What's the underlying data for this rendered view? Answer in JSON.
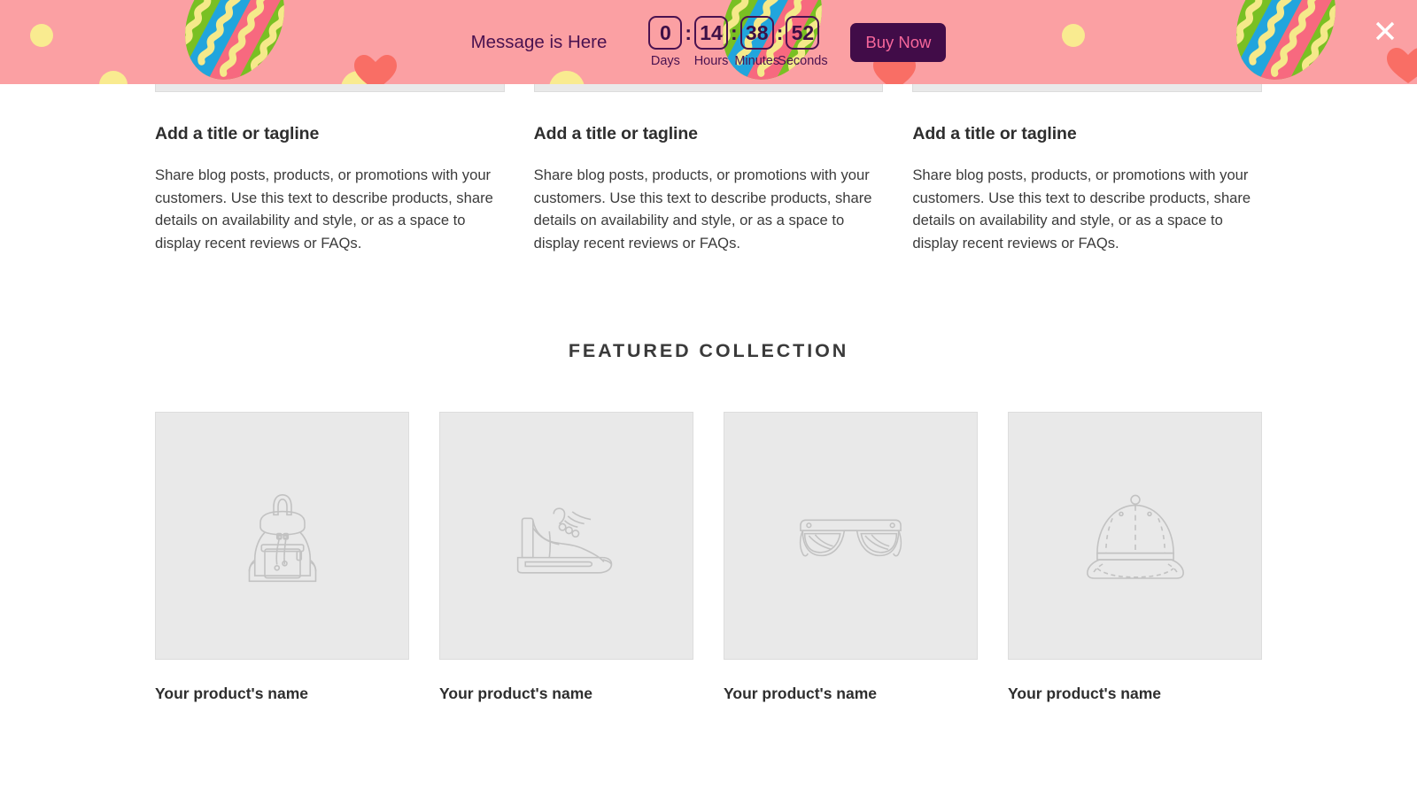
{
  "banner": {
    "message": "Message is Here",
    "units": [
      {
        "value": "0",
        "label": "Days"
      },
      {
        "value": "14",
        "label": "Hours"
      },
      {
        "value": "38",
        "label": "Minutes"
      },
      {
        "value": "52",
        "label": "Seconds"
      }
    ],
    "separator": ":",
    "buy_label": "Buy Now",
    "close_icon": "close-icon",
    "colors": {
      "background": "#fba0a3",
      "text": "#4a1250",
      "box_border": "#4a1250",
      "button_bg": "#410c48",
      "button_text": "#f7679b",
      "egg_yellow": "#f5e98a",
      "egg_blue": "#21a5dd",
      "egg_pink": "#f7697f",
      "egg_green": "#79c023",
      "heart": "#f96e65",
      "dot_yellow": "#f9eb90"
    }
  },
  "columns": [
    {
      "title": "Add a title or tagline",
      "body": "Share blog posts, products, or promotions with your customers. Use this text to describe products, share details on availability and style, or as a space to display recent reviews or FAQs.",
      "media_icon": "image-placeholder"
    },
    {
      "title": "Add a title or tagline",
      "body": "Share blog posts, products, or promotions with your customers. Use this text to describe products, share details on availability and style, or as a space to display recent reviews or FAQs.",
      "media_icon": "image-placeholder"
    },
    {
      "title": "Add a title or tagline",
      "body": "Share blog posts, products, or promotions with your customers. Use this text to describe products, share details on availability and style, or as a space to display recent reviews or FAQs.",
      "media_icon": "image-placeholder"
    }
  ],
  "featured": {
    "heading": "Featured collection",
    "products": [
      {
        "name": "Your product's name",
        "media_icon": "backpack-icon"
      },
      {
        "name": "Your product's name",
        "media_icon": "sneaker-icon"
      },
      {
        "name": "Your product's name",
        "media_icon": "eyeglasses-icon"
      },
      {
        "name": "Your product's name",
        "media_icon": "cap-icon"
      }
    ]
  }
}
